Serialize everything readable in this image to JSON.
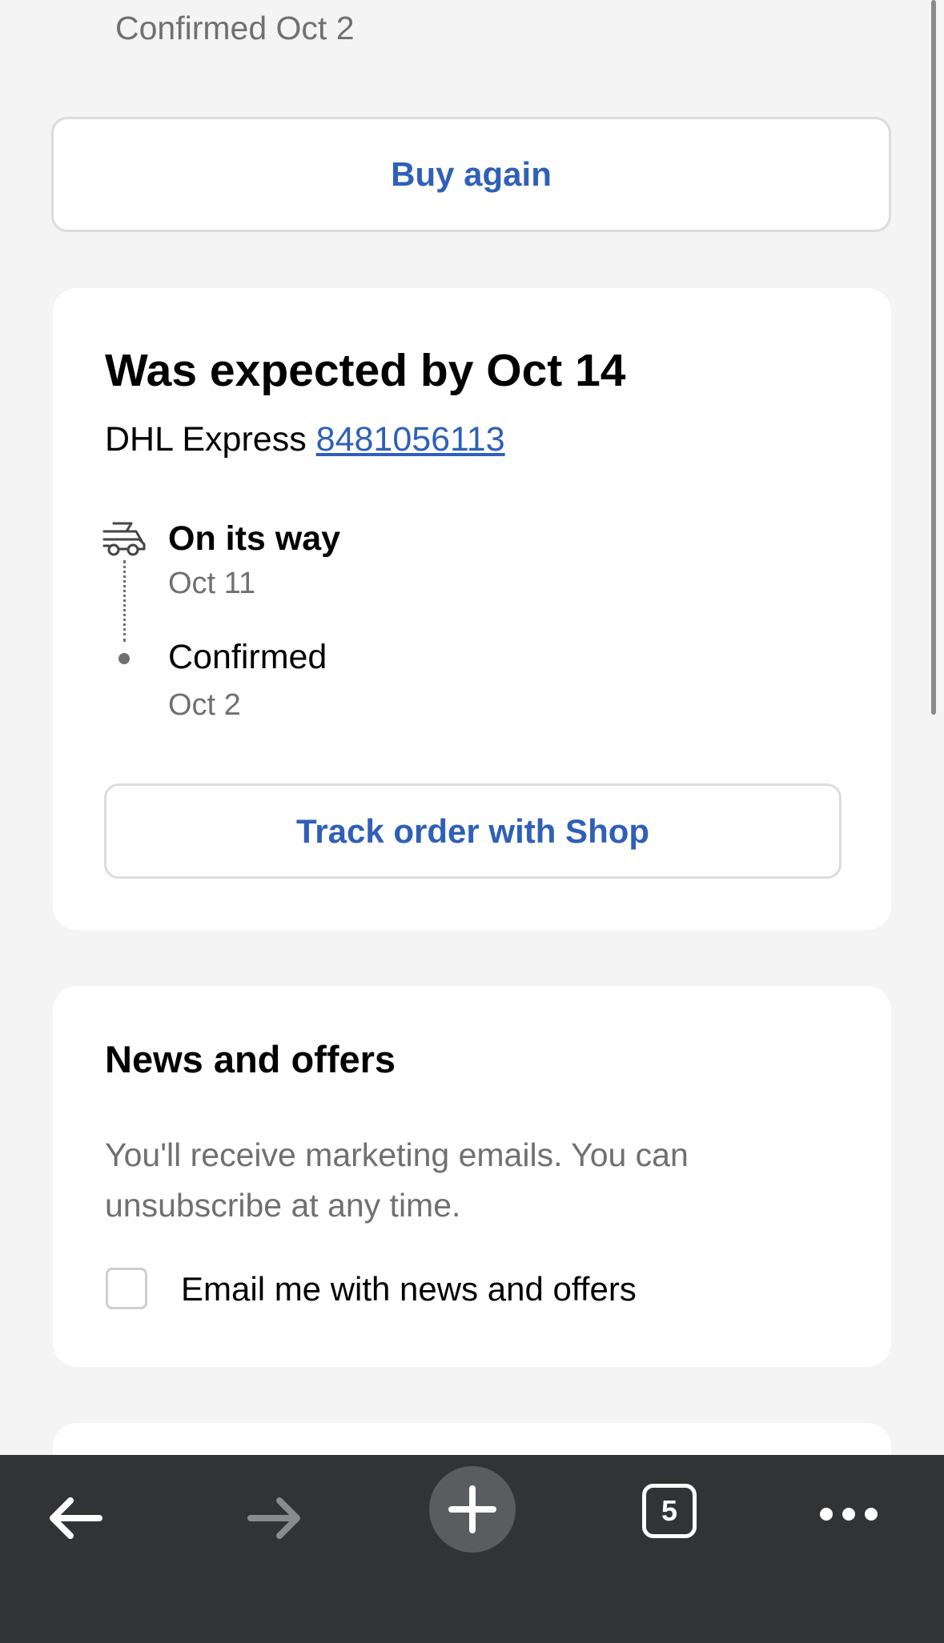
{
  "top": {
    "confirmed_text": "Confirmed Oct 2",
    "buy_again_label": "Buy again"
  },
  "tracking": {
    "title": "Was expected by Oct 14",
    "carrier": "DHL Express",
    "tracking_number": "8481056113",
    "steps": [
      {
        "label": "On its way",
        "date": "Oct 11",
        "icon": "truck-icon"
      },
      {
        "label": "Confirmed",
        "date": "Oct 2",
        "icon": "dot"
      }
    ],
    "track_button_label": "Track order with Shop"
  },
  "news": {
    "title": "News and offers",
    "description": "You'll receive marketing emails. You can unsubscribe at any time.",
    "checkbox_label": "Email me with news and offers",
    "checked": false
  },
  "toolbar": {
    "tab_count": "5",
    "icons": [
      "back-arrow-icon",
      "forward-arrow-icon",
      "plus-icon",
      "tabs-icon",
      "more-icon"
    ]
  },
  "colors": {
    "accent": "#2f5fb8",
    "background": "#f4f4f4",
    "toolbar": "#323336",
    "muted_text": "#707070"
  }
}
